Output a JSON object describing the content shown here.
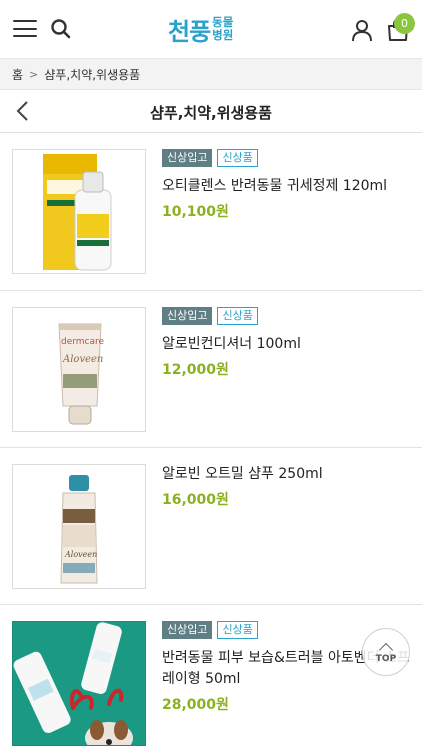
{
  "header": {
    "logo_main": "천풍",
    "logo_sub_top": "동물",
    "logo_sub_bottom": "병원",
    "cart_count": "0"
  },
  "breadcrumb": {
    "home": "홈",
    "current": "샴푸,치약,위생용품"
  },
  "page": {
    "title": "샴푸,치약,위생용품"
  },
  "products": [
    {
      "badge_new": "신상입고",
      "badge_fresh": "신상품",
      "name": "오티클렌스 반려동물 귀세정제 120ml",
      "price": "10,100원"
    },
    {
      "badge_new": "신상입고",
      "badge_fresh": "신상품",
      "name": "알로빈컨디셔너 100ml",
      "price": "12,000원"
    },
    {
      "name": "알로빈 오트밀 샴푸 250ml",
      "price": "16,000원"
    },
    {
      "badge_new": "신상입고",
      "badge_fresh": "신상품",
      "name": "반려동물 피부 보습&트러블 아토벤더 스프레이형 50ml",
      "price": "28,000원"
    }
  ],
  "scroll_top": {
    "label": "TOP"
  },
  "colors": {
    "brand": "#2aa2c9",
    "price": "#8cb120",
    "badge_bg": "#5f7f85",
    "cart_badge": "#8cc63f"
  }
}
